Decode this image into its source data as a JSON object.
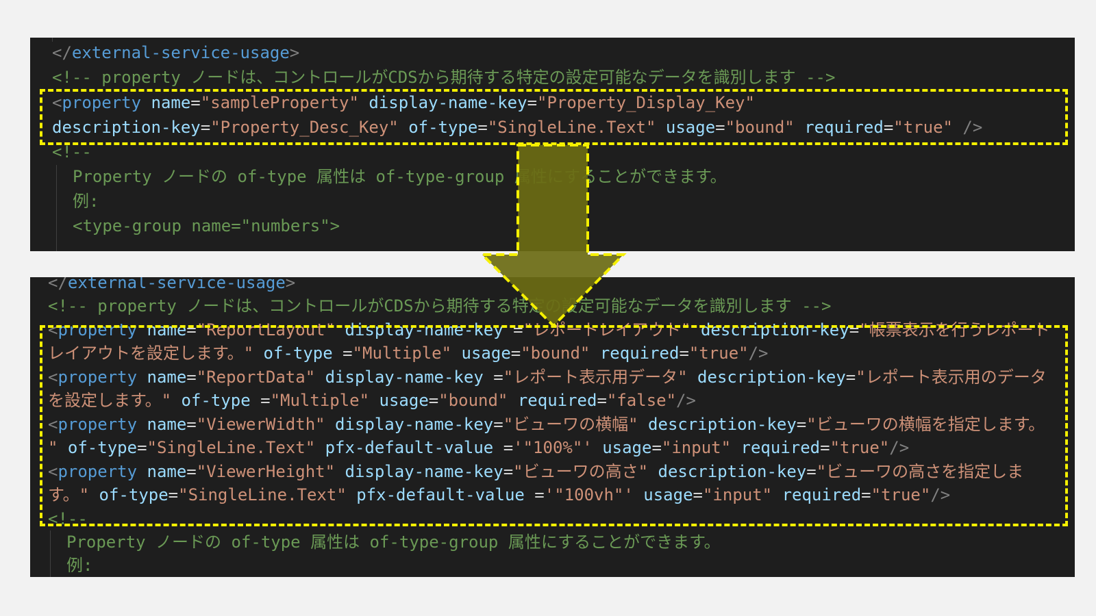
{
  "panel_top": {
    "line1": {
      "open": "</",
      "tag": "external-service-usage",
      "close": ">"
    },
    "comment": "<!-- property ノードは、コントロールがCDSから期待する特定の設定可能なデータを識別します -->",
    "prop": {
      "open": "<",
      "tag": "property",
      "name_attr": "name",
      "name_val": "\"sampleProperty\"",
      "dnk_attr": "display-name-key",
      "dnk_val": "\"Property_Display_Key\"",
      "desc_attr": "description-key",
      "desc_val": "\"Property_Desc_Key\"",
      "type_attr": "of-type",
      "type_val": "\"SingleLine.Text\"",
      "usage_attr": "usage",
      "usage_val": "\"bound\"",
      "req_attr": "required",
      "req_val": "\"true\"",
      "close": " />"
    },
    "comment_open": "<!--",
    "comment_line2": "Property ノードの of-type 属性は of-type-group 属性にすることができます。",
    "comment_line3": "例:",
    "comment_line4": "<type-group name=\"numbers\">"
  },
  "panel_bottom": {
    "line1": {
      "open": "</",
      "tag": "external-service-usage",
      "close": ">"
    },
    "comment": "<!-- property ノードは、コントロールがCDSから期待する特定の設定可能なデータを識別します -->",
    "p1": {
      "name_val": "\"ReportLayout\"",
      "dnk_val": "\"レポートレイアウト\"",
      "desc_val_a": "\"帳票表示を行うレポート",
      "desc_val_b": "レイアウトを設定します。\"",
      "type_val": "\"Multiple\"",
      "usage_val": "\"bound\"",
      "req_val": "\"true\""
    },
    "p2": {
      "name_val": "\"ReportData\"",
      "dnk_val": "\"レポート表示用データ\"",
      "desc_val_a": "\"レポート表示用のデータ",
      "desc_val_b": "を設定します。\"",
      "type_val": "\"Multiple\"",
      "usage_val": "\"bound\"",
      "req_val": "\"false\""
    },
    "p3": {
      "name_val": "\"ViewerWidth\"",
      "dnk_val": "\"ビューワの横幅\"",
      "desc_val_a": "\"ビューワの横幅を指定します。",
      "desc_val_b": "\"",
      "type_val": "\"SingleLine.Text\"",
      "default_val": "'\"100%\"'",
      "usage_val": "\"input\"",
      "req_val": "\"true\""
    },
    "p4": {
      "name_val": "\"ViewerHeight\"",
      "dnk_val": "\"ビューワの高さ\"",
      "desc_val_a": "\"ビューワの高さを指定しま",
      "desc_val_b": "す。\"",
      "type_val": "\"SingleLine.Text\"",
      "default_val": "'\"100vh\"'",
      "usage_val": "\"input\"",
      "req_val": "\"true\""
    },
    "comment_open": "<!--",
    "comment_line2": "Property ノードの of-type 属性は of-type-group 属性にすることができます。",
    "comment_line3": "例:"
  },
  "colors": {
    "editor_bg": "#1e1e1e",
    "tag": "#569cd6",
    "attribute": "#9cdcfe",
    "string": "#ce9178",
    "comment": "#6a9955",
    "highlight": "#f5f000",
    "arrow_fill": "#6b6b14"
  },
  "icons": [
    "down-arrow-icon"
  ]
}
